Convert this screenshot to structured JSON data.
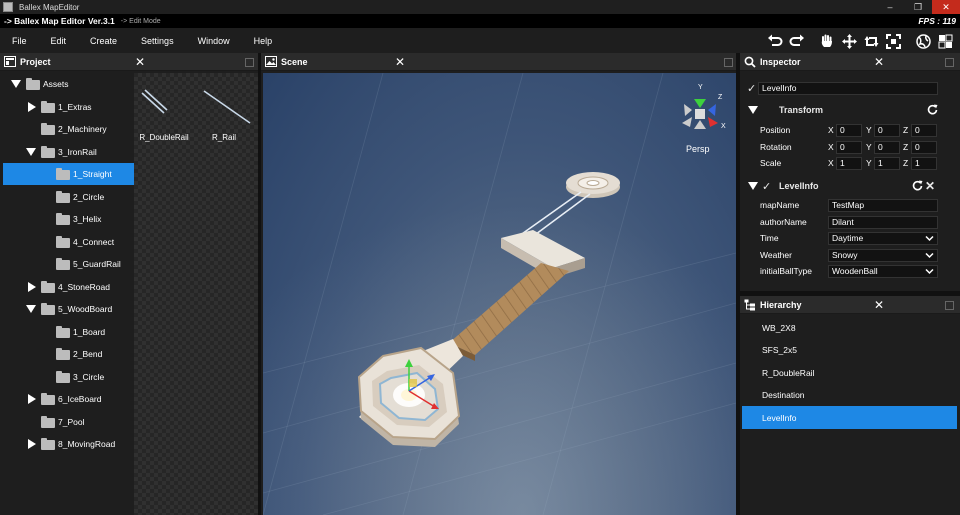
{
  "window": {
    "title": "Ballex MapEditor",
    "version_label": "-> Ballex Map Editor Ver.3.1",
    "mode_label": "-> Edit Mode",
    "fps_label": "FPS : 119"
  },
  "menu": [
    "File",
    "Edit",
    "Create",
    "Settings",
    "Window",
    "Help"
  ],
  "toolbar_icons": [
    "undo-icon",
    "redo-icon",
    "hand-icon",
    "move-icon",
    "rotate-icon",
    "scale-icon",
    "globe-icon",
    "grid-toggle-icon"
  ],
  "project": {
    "title": "Project",
    "tree": [
      {
        "label": "Assets",
        "depth": 0,
        "toggle": "down"
      },
      {
        "label": "1_Extras",
        "depth": 1,
        "toggle": "right"
      },
      {
        "label": "2_Machinery",
        "depth": 1,
        "toggle": "none"
      },
      {
        "label": "3_IronRail",
        "depth": 1,
        "toggle": "down"
      },
      {
        "label": "1_Straight",
        "depth": 2,
        "toggle": "none",
        "selected": true
      },
      {
        "label": "2_Circle",
        "depth": 2,
        "toggle": "none"
      },
      {
        "label": "3_Helix",
        "depth": 2,
        "toggle": "none"
      },
      {
        "label": "4_Connect",
        "depth": 2,
        "toggle": "none"
      },
      {
        "label": "5_GuardRail",
        "depth": 2,
        "toggle": "none"
      },
      {
        "label": "4_StoneRoad",
        "depth": 1,
        "toggle": "right"
      },
      {
        "label": "5_WoodBoard",
        "depth": 1,
        "toggle": "down"
      },
      {
        "label": "1_Board",
        "depth": 2,
        "toggle": "none"
      },
      {
        "label": "2_Bend",
        "depth": 2,
        "toggle": "none"
      },
      {
        "label": "3_Circle",
        "depth": 2,
        "toggle": "none"
      },
      {
        "label": "6_IceBoard",
        "depth": 1,
        "toggle": "right"
      },
      {
        "label": "7_Pool",
        "depth": 1,
        "toggle": "none"
      },
      {
        "label": "8_MovingRoad",
        "depth": 1,
        "toggle": "right"
      }
    ],
    "assets": [
      "R_DoubleRail",
      "R_Rail"
    ]
  },
  "scene": {
    "title": "Scene",
    "gizmo": {
      "x": "X",
      "y": "Y",
      "z": "Z",
      "projection": "Persp"
    }
  },
  "inspector": {
    "title": "Inspector",
    "object_name": "LevelInfo",
    "transform": {
      "title": "Transform",
      "rows": [
        {
          "label": "Position",
          "x": "0",
          "y": "0",
          "z": "0"
        },
        {
          "label": "Rotation",
          "x": "0",
          "y": "0",
          "z": "0"
        },
        {
          "label": "Scale",
          "x": "1",
          "y": "1",
          "z": "1"
        }
      ],
      "axes": {
        "x": "X",
        "y": "Y",
        "z": "Z"
      }
    },
    "component": {
      "title": "LevelInfo",
      "fields": [
        {
          "label": "mapName",
          "value": "TestMap",
          "kind": "text"
        },
        {
          "label": "authorName",
          "value": "Dilant",
          "kind": "text"
        },
        {
          "label": "Time",
          "value": "Daytime",
          "kind": "select"
        },
        {
          "label": "Weather",
          "value": "Snowy",
          "kind": "select"
        },
        {
          "label": "initialBallType",
          "value": "WoodenBall",
          "kind": "select"
        }
      ]
    }
  },
  "hierarchy": {
    "title": "Hierarchy",
    "items": [
      {
        "label": "WB_2X8"
      },
      {
        "label": "SFS_2x5"
      },
      {
        "label": "R_DoubleRail"
      },
      {
        "label": "Destination"
      },
      {
        "label": "LevelInfo",
        "selected": true
      }
    ]
  },
  "colors": {
    "accent": "#1e88e5",
    "panel": "#1e1e1e",
    "header": "#2b2b2b",
    "close_button": "#c42b1c"
  }
}
